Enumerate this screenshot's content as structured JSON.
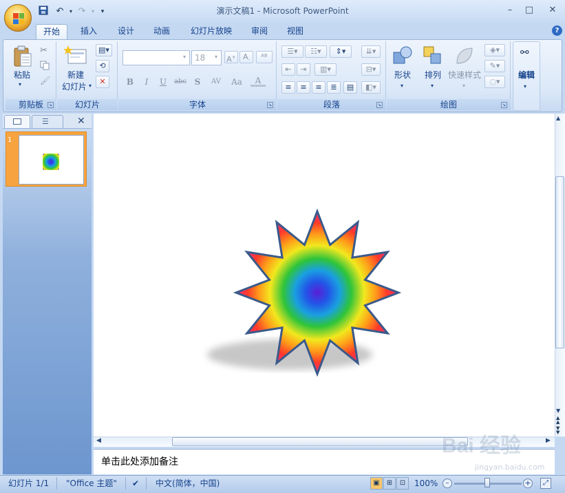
{
  "window": {
    "title": "演示文稿1 - Microsoft PowerPoint",
    "controls": [
      "–",
      "□",
      "✕"
    ]
  },
  "quick_access": {
    "icons": [
      "save-icon",
      "undo-icon",
      "redo-icon",
      "customize-icon"
    ]
  },
  "tabs": [
    {
      "label": "开始",
      "active": true
    },
    {
      "label": "插入"
    },
    {
      "label": "设计"
    },
    {
      "label": "动画"
    },
    {
      "label": "幻灯片放映"
    },
    {
      "label": "审阅"
    },
    {
      "label": "视图"
    }
  ],
  "ribbon": {
    "clipboard": {
      "paste_label": "粘贴",
      "group_label": "剪贴板"
    },
    "slides": {
      "new_slide_line1": "新建",
      "new_slide_line2": "幻灯片",
      "group_label": "幻灯片"
    },
    "font": {
      "font_name": "",
      "font_size": "18",
      "group_label": "字体",
      "buttons": [
        "B",
        "I",
        "U",
        "abc",
        "S",
        "AV",
        "Aa",
        "A"
      ]
    },
    "paragraph": {
      "group_label": "段落"
    },
    "drawing": {
      "shapes_label": "形状",
      "arrange_label": "排列",
      "quick_styles_label": "快速样式",
      "group_label": "绘图"
    },
    "editing": {
      "label": "编辑"
    }
  },
  "slides_panel": {
    "slide_number": "1",
    "close_symbol": "✕"
  },
  "slide": {
    "shape": "12-point star",
    "fill": "rainbow radial gradient",
    "colors": [
      "#5a1fd6",
      "#2255e8",
      "#1aa0e0",
      "#2ec43a",
      "#f2e81e",
      "#ff9a1a",
      "#ff3a2a",
      "#ff2a7a"
    ],
    "outline_color": "#3a5a8a"
  },
  "notes": {
    "placeholder": "单击此处添加备注"
  },
  "status": {
    "slide_count": "幻灯片 1/1",
    "theme": "\"Office 主题\"",
    "language": "中文(简体，中国)",
    "zoom": "100%"
  },
  "watermark": {
    "text": "Bai 经验",
    "url": "jingyan.baidu.com"
  }
}
